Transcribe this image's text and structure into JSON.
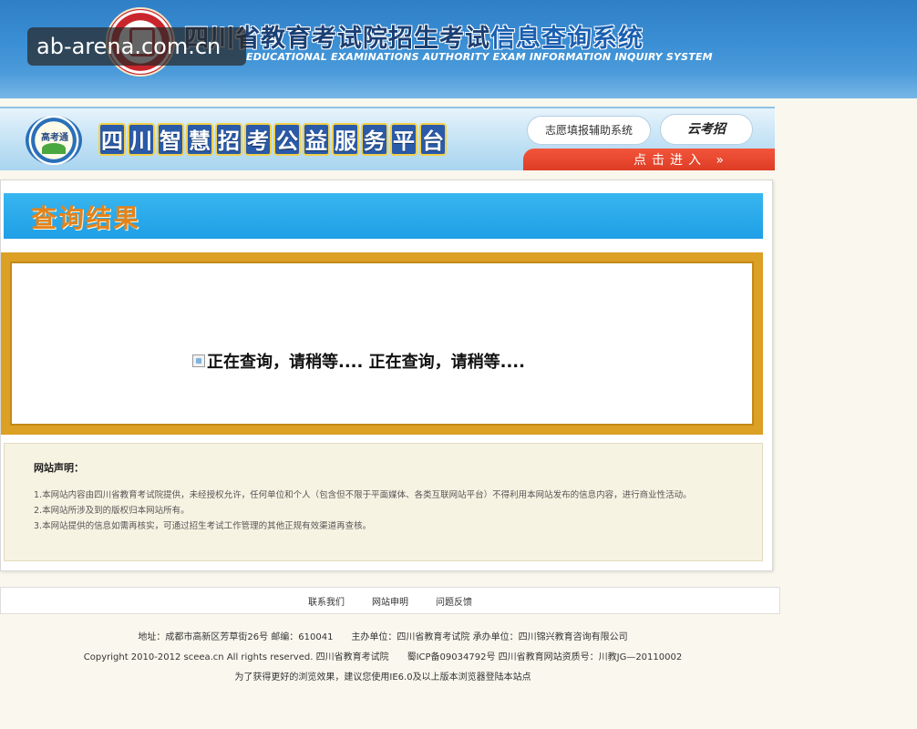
{
  "header": {
    "title_main": "四川省教育考试院招生考试",
    "title_highlight": "信息查询系统",
    "subtitle": "EDUCATIONAL EXAMINATIONS AUTHORITY EXAM INFORMATION INQUIRY SYSTEM",
    "emblem_icon": "exam-authority-emblem-icon"
  },
  "watermark": {
    "text": "ab-arena.com.cn"
  },
  "banner": {
    "logo_icon": "gaokaotong-logo-icon",
    "logo_text": "高考通",
    "title_chars": [
      "四",
      "川",
      "智",
      "慧",
      "招",
      "考",
      "公",
      "益",
      "服",
      "务",
      "平",
      "台"
    ],
    "volunteer_button": "志愿填报辅助系统",
    "gaokaopai_button": "云考招",
    "enter_label": "点击进入 »"
  },
  "result": {
    "title": "查询结果",
    "loading_text": "正在查询，请稍等.... 正在查询，请稍等....",
    "broken_image_icon": "broken-image-icon"
  },
  "disclaimer": {
    "title": "网站声明：",
    "lines": [
      "1.本网站内容由四川省教育考试院提供，未经授权允许，任何单位和个人（包含但不限于平面媒体、各类互联网站平台）不得利用本网站发布的信息内容，进行商业性活动。",
      "2.本网站所涉及到的版权归本网站所有。",
      "3.本网站提供的信息如需再核实，可通过招生考试工作管理的其他正规有效渠道再查核。"
    ]
  },
  "footer": {
    "nav": [
      "联系我们",
      "网站申明",
      "问题反馈"
    ],
    "address": "地址：成都市高新区芳草街26号 邮编：610041　　主办单位：四川省教育考试院 承办单位：四川锦兴教育咨询有限公司",
    "copyright": "Copyright 2010-2012 sceea.cn All rights reserved. 四川省教育考试院　　蜀ICP备09034792号 四川省教育网站资质号：川教JG—20110002",
    "browser_note": "为了获得更好的浏览效果，建议您使用IE6.0及以上版本浏览器登陆本站点"
  },
  "colors": {
    "header_blue": "#2f7fc6",
    "banner_title_blue": "#2a5aa8",
    "enter_red": "#dc3a22",
    "result_bar_blue": "#1f9fe6",
    "result_title_orange": "#e4831c",
    "result_frame_gold": "#dba024",
    "disclaimer_bg": "#f7f3e3"
  }
}
